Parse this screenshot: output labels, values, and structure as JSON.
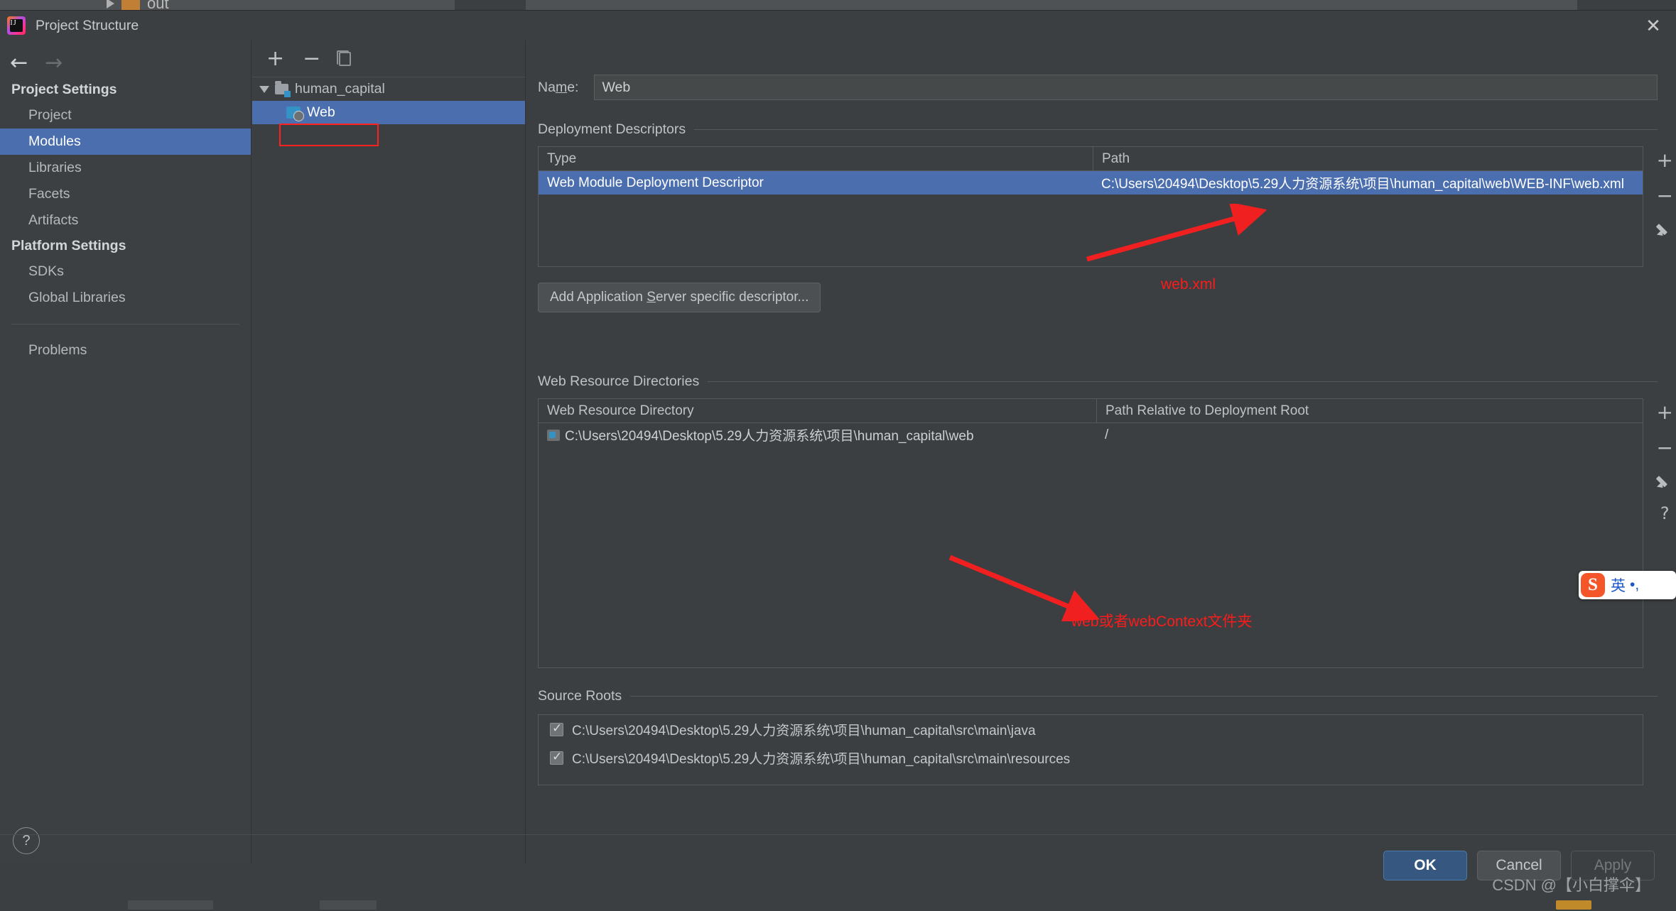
{
  "ide_background": {
    "tree_item": "out"
  },
  "dialog": {
    "title": "Project Structure",
    "close_icon": "close-icon"
  },
  "sidebar": {
    "back_icon": "←",
    "forward_icon": "→",
    "groups": [
      {
        "heading": "Project Settings",
        "items": [
          {
            "label": "Project",
            "selected": false
          },
          {
            "label": "Modules",
            "selected": true
          },
          {
            "label": "Libraries",
            "selected": false
          },
          {
            "label": "Facets",
            "selected": false
          },
          {
            "label": "Artifacts",
            "selected": false
          }
        ]
      },
      {
        "heading": "Platform Settings",
        "items": [
          {
            "label": "SDKs",
            "selected": false
          },
          {
            "label": "Global Libraries",
            "selected": false
          }
        ]
      }
    ],
    "problems": "Problems",
    "help_label": "?"
  },
  "tree_panel": {
    "toolbar": {
      "add": "+",
      "remove": "−",
      "copy": "copy-icon"
    },
    "nodes": [
      {
        "label": "human_capital",
        "level": 0,
        "selected": false
      },
      {
        "label": "Web",
        "level": 1,
        "selected": true
      }
    ]
  },
  "main": {
    "name_field": {
      "label_pre": "Na",
      "label_mnemonic": "m",
      "label_post": "e:",
      "value": "Web"
    },
    "deployment_descriptors": {
      "title": "Deployment Descriptors",
      "columns": [
        "Type",
        "Path"
      ],
      "rows": [
        {
          "type": "Web Module Deployment Descriptor",
          "path": "C:\\Users\\20494\\Desktop\\5.29人力资源系统\\项目\\human_capital\\web\\WEB-INF\\web.xml",
          "selected": true
        }
      ],
      "add_button": {
        "pre": "Add Application ",
        "mnemonic": "S",
        "post": "erver specific descriptor..."
      },
      "side_controls": [
        "+",
        "−",
        "edit-pencil"
      ]
    },
    "web_resource_directories": {
      "title": "Web Resource Directories",
      "columns": [
        "Web Resource Directory",
        "Path Relative to Deployment Root"
      ],
      "rows": [
        {
          "directory": "C:\\Users\\20494\\Desktop\\5.29人力资源系统\\项目\\human_capital\\web",
          "relative": "/"
        }
      ],
      "side_controls": [
        "+",
        "−",
        "edit-pencil",
        "?"
      ]
    },
    "source_roots": {
      "title": "Source Roots",
      "items": [
        {
          "checked": true,
          "path": "C:\\Users\\20494\\Desktop\\5.29人力资源系统\\项目\\human_capital\\src\\main\\java"
        },
        {
          "checked": true,
          "path": "C:\\Users\\20494\\Desktop\\5.29人力资源系统\\项目\\human_capital\\src\\main\\resources"
        }
      ]
    }
  },
  "annotations": [
    {
      "text": "web.xml",
      "color": "#fb1b1b"
    },
    {
      "text": "web或者webContext文件夹",
      "color": "#fb1b1b"
    }
  ],
  "footer": {
    "ok": "OK",
    "cancel": "Cancel",
    "apply": "Apply",
    "watermark": "CSDN @【小白撑伞】"
  },
  "sogou_ime": {
    "logo": "S",
    "mode": "英",
    "punct": "•,"
  },
  "colors": {
    "accent_selection": "#4b6eaf",
    "dialog_bg": "#3c3f41",
    "sidebar_bg": "#3c4043",
    "annotation_red": "#fb1b1b",
    "ok_button": "#365880"
  }
}
